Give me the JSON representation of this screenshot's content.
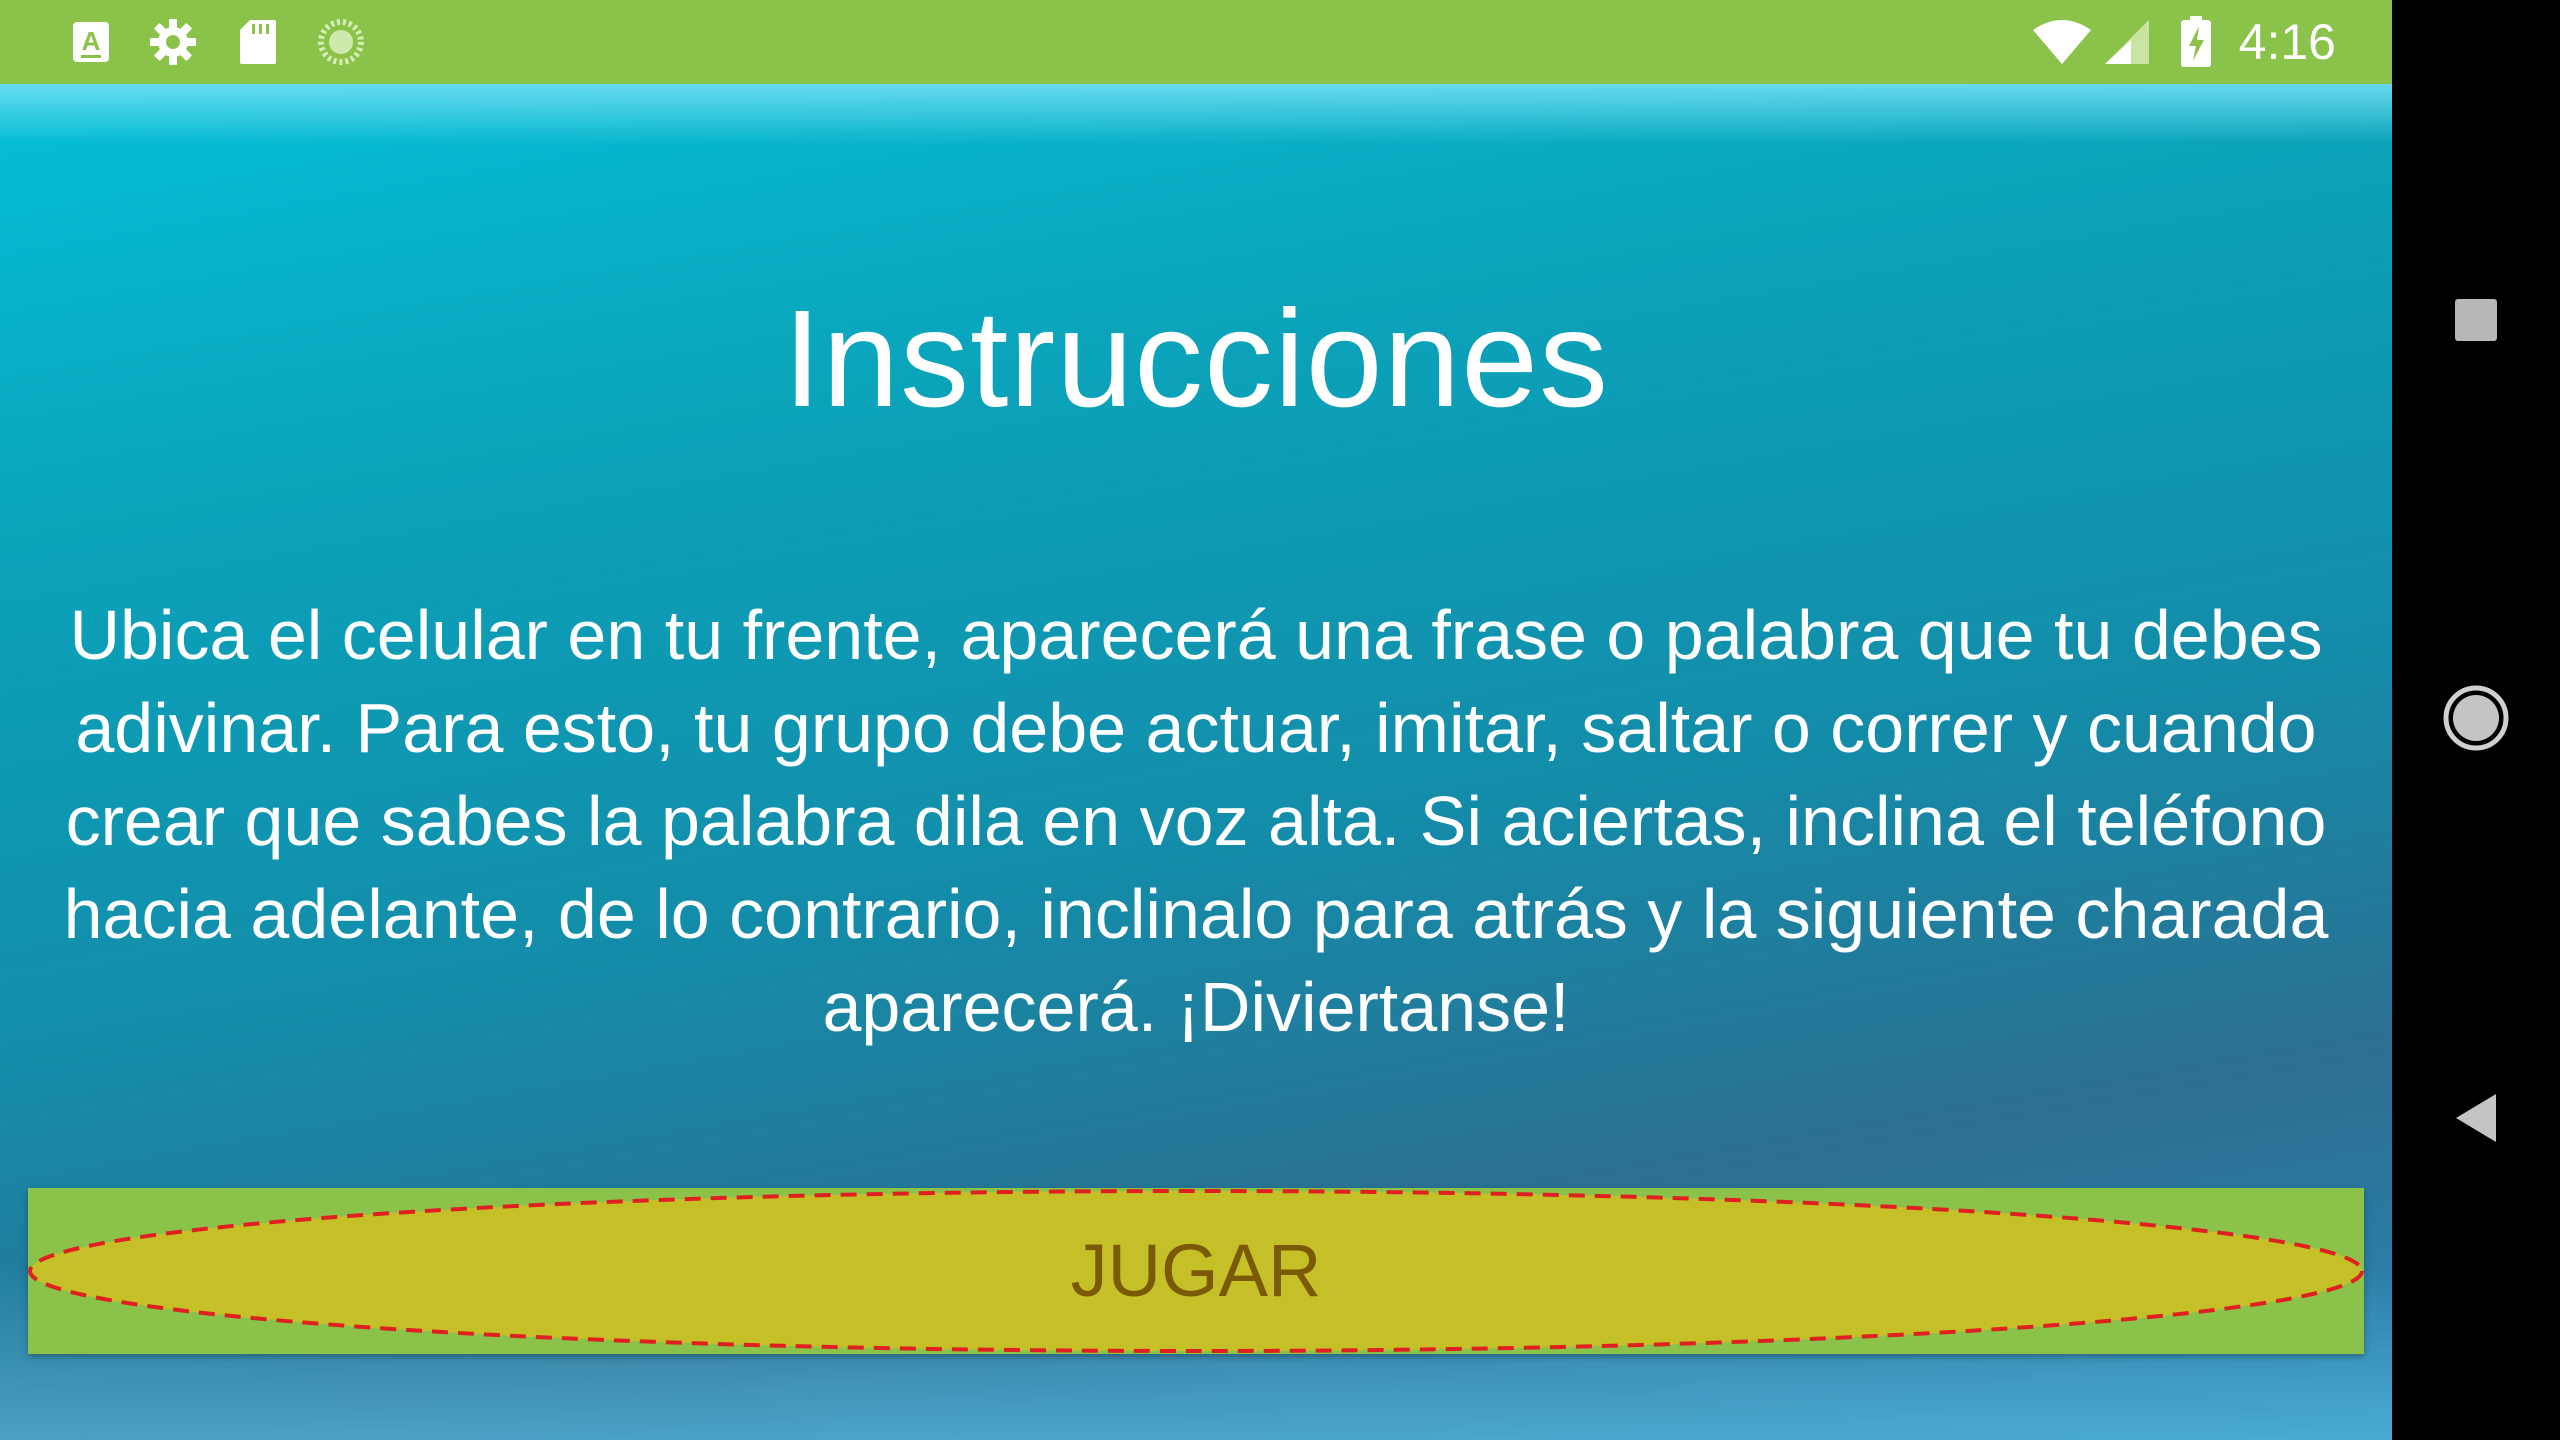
{
  "status_bar": {
    "time": "4:16",
    "background_color": "#8bc34a",
    "left_icons": [
      "keyboard-a-icon",
      "settings-gear-icon",
      "sd-card-icon",
      "loading-spinner-icon"
    ],
    "right_icons": [
      "wifi-icon",
      "cellular-signal-icon",
      "battery-charging-icon"
    ],
    "keyboard_icon_letter": "A"
  },
  "main": {
    "title": "Instrucciones",
    "instructions": "Ubica el celular en tu frente, aparecerá una frase o palabra que tu debes adivinar. Para esto, tu grupo debe actuar, imitar, saltar o correr y cuando crear que sabes la palabra dila en voz alta. Si aciertas, inclina el teléfono hacia adelante, de lo contrario, inclinalo para atrás y la siguiente charada aparecerá. ¡Diviertanse!",
    "play_button_label": "JUGAR",
    "play_button_color": "#8bc34a",
    "play_button_highlight_color": "#c5c027",
    "play_button_outline_color": "#e02020"
  },
  "nav_bar": {
    "buttons": [
      "recents-square-icon",
      "home-circle-icon",
      "back-triangle-icon"
    ]
  }
}
